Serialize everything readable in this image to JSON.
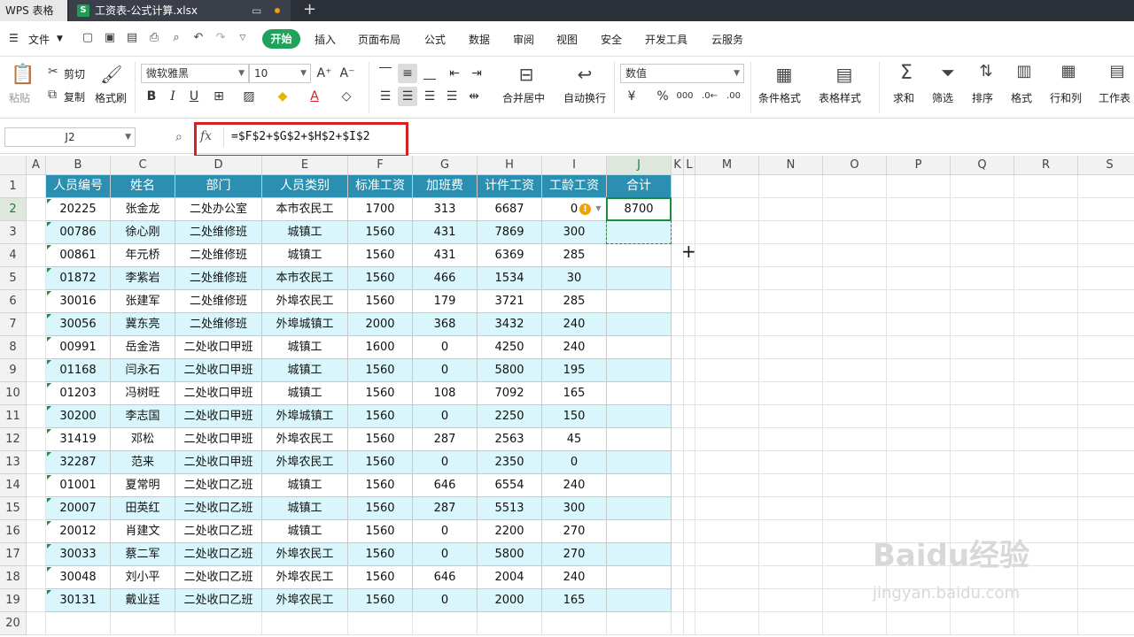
{
  "titlebar": {
    "app_tab": "WPS 表格",
    "doc_tab": "工资表-公式计算.xlsx",
    "sheet_glyph": "S",
    "add_glyph": "+"
  },
  "menu": {
    "file": "文件",
    "tabs": [
      "开始",
      "插入",
      "页面布局",
      "公式",
      "数据",
      "审阅",
      "视图",
      "安全",
      "开发工具",
      "云服务"
    ]
  },
  "ribbon": {
    "paste": "粘贴",
    "cut": "剪切",
    "copy": "复制",
    "format_painter": "格式刷",
    "font_name": "微软雅黑",
    "font_size": "10",
    "merge_center": "合并居中",
    "wrap_text": "自动换行",
    "number_format": "数值",
    "cond_format": "条件格式",
    "table_style": "表格样式",
    "sum": "求和",
    "filter": "筛选",
    "sort": "排序",
    "format": "格式",
    "row_col": "行和列",
    "worksheet": "工作表"
  },
  "formula_bar": {
    "name_box": "J2",
    "fx": "fx",
    "formula": "=$F$2+$G$2+$H$2+$I$2"
  },
  "columns": [
    "A",
    "B",
    "C",
    "D",
    "E",
    "F",
    "G",
    "H",
    "I",
    "J",
    "K",
    "L",
    "M",
    "N",
    "O",
    "P",
    "Q",
    "R",
    "S"
  ],
  "row_numbers": [
    "1",
    "2",
    "3",
    "4",
    "5",
    "6",
    "7",
    "8",
    "9",
    "10",
    "11",
    "12",
    "13",
    "14",
    "15",
    "16",
    "17",
    "18",
    "19",
    "20"
  ],
  "table": {
    "headers": [
      "人员编号",
      "姓名",
      "部门",
      "人员类别",
      "标准工资",
      "加班费",
      "计件工资",
      "工龄工资",
      "合计"
    ],
    "rows": [
      [
        "20225",
        "张金龙",
        "二处办公室",
        "本市农民工",
        "1700",
        "313",
        "6687",
        "0",
        "8700"
      ],
      [
        "00786",
        "徐心刚",
        "二处维修班",
        "城镇工",
        "1560",
        "431",
        "7869",
        "300",
        ""
      ],
      [
        "00861",
        "年元桥",
        "二处维修班",
        "城镇工",
        "1560",
        "431",
        "6369",
        "285",
        ""
      ],
      [
        "01872",
        "李紫岩",
        "二处维修班",
        "本市农民工",
        "1560",
        "466",
        "1534",
        "30",
        ""
      ],
      [
        "30016",
        "张建军",
        "二处维修班",
        "外埠农民工",
        "1560",
        "179",
        "3721",
        "285",
        ""
      ],
      [
        "30056",
        "冀东亮",
        "二处维修班",
        "外埠城镇工",
        "2000",
        "368",
        "3432",
        "240",
        ""
      ],
      [
        "00991",
        "岳金浩",
        "二处收口甲班",
        "城镇工",
        "1600",
        "0",
        "4250",
        "240",
        ""
      ],
      [
        "01168",
        "闫永石",
        "二处收口甲班",
        "城镇工",
        "1560",
        "0",
        "5800",
        "195",
        ""
      ],
      [
        "01203",
        "冯树旺",
        "二处收口甲班",
        "城镇工",
        "1560",
        "108",
        "7092",
        "165",
        ""
      ],
      [
        "30200",
        "李志国",
        "二处收口甲班",
        "外埠城镇工",
        "1560",
        "0",
        "2250",
        "150",
        ""
      ],
      [
        "31419",
        "邓松",
        "二处收口甲班",
        "外埠农民工",
        "1560",
        "287",
        "2563",
        "45",
        ""
      ],
      [
        "32287",
        "范来",
        "二处收口甲班",
        "外埠农民工",
        "1560",
        "0",
        "2350",
        "0",
        ""
      ],
      [
        "01001",
        "夏常明",
        "二处收口乙班",
        "城镇工",
        "1560",
        "646",
        "6554",
        "240",
        ""
      ],
      [
        "20007",
        "田英红",
        "二处收口乙班",
        "城镇工",
        "1560",
        "287",
        "5513",
        "300",
        ""
      ],
      [
        "20012",
        "肖建文",
        "二处收口乙班",
        "城镇工",
        "1560",
        "0",
        "2200",
        "270",
        ""
      ],
      [
        "30033",
        "蔡二军",
        "二处收口乙班",
        "外埠农民工",
        "1560",
        "0",
        "5800",
        "270",
        ""
      ],
      [
        "30048",
        "刘小平",
        "二处收口乙班",
        "外埠农民工",
        "1560",
        "646",
        "2004",
        "240",
        ""
      ],
      [
        "30131",
        "戴业廷",
        "二处收口乙班",
        "外埠农民工",
        "1560",
        "0",
        "2000",
        "165",
        ""
      ]
    ]
  },
  "colors": {
    "accent": "#1fa35a",
    "header_fill": "#2a8fb0",
    "alt_row": "#d8f6fb",
    "highlight_box": "#d9221f"
  },
  "watermark": {
    "main": "Baidu经验",
    "sub": "jingyan.baidu.com"
  }
}
